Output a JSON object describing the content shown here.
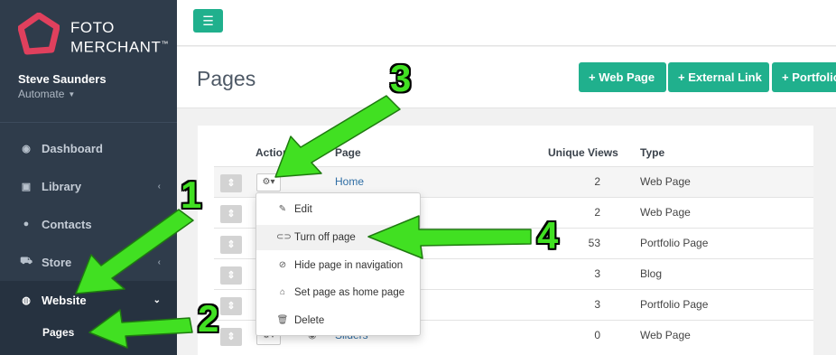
{
  "brand": {
    "line1": "FOTO",
    "line2": "MERCHANT",
    "tm": "™"
  },
  "user": {
    "name": "Steve Saunders",
    "role": "Automate"
  },
  "nav": {
    "items": [
      {
        "label": "Dashboard",
        "icon": "dashboard-icon"
      },
      {
        "label": "Library",
        "icon": "image-icon"
      },
      {
        "label": "Contacts",
        "icon": "user-icon"
      },
      {
        "label": "Store",
        "icon": "cart-icon"
      },
      {
        "label": "Website",
        "icon": "globe-icon"
      }
    ],
    "sub_active": "Pages"
  },
  "header": {
    "title": "Pages",
    "buttons": [
      "+ Web Page",
      "+ External Link",
      "+ Portfolio"
    ]
  },
  "table": {
    "columns": [
      "Actions",
      "Page",
      "Unique Views",
      "Type"
    ],
    "rows": [
      {
        "page": "Home",
        "views": "2",
        "type": "Web Page"
      },
      {
        "page": "",
        "views": "2",
        "type": "Web Page"
      },
      {
        "page": "",
        "views": "53",
        "type": "Portfolio Page"
      },
      {
        "page": "",
        "views": "3",
        "type": "Blog"
      },
      {
        "page": "",
        "views": "3",
        "type": "Portfolio Page"
      },
      {
        "page": "Sliders",
        "views": "0",
        "type": "Web Page"
      }
    ]
  },
  "dropdown": {
    "items": [
      {
        "label": "Edit",
        "icon": "pencil-icon"
      },
      {
        "label": "Turn off page",
        "icon": "toggle-icon"
      },
      {
        "label": "Hide page in navigation",
        "icon": "eye-slash-icon"
      },
      {
        "label": "Set page as home page",
        "icon": "home-icon"
      },
      {
        "label": "Delete",
        "icon": "trash-icon"
      }
    ]
  },
  "annotations": {
    "labels": [
      "1",
      "2",
      "3",
      "4"
    ],
    "color": "#41e022"
  },
  "colors": {
    "accent": "#20b08d",
    "sidebar": "#2f3c4b",
    "link": "#2e6da4",
    "logo": "#e0405d"
  }
}
